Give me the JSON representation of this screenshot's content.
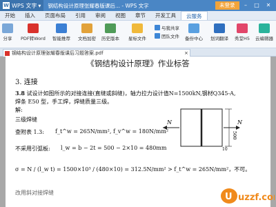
{
  "titlebar": {
    "app_name": "WPS 文字",
    "doc_title": "钢结构设计原理张耀春版课后... - WPS 文字",
    "login": "未登录"
  },
  "menu": {
    "tabs": [
      "开始",
      "插入",
      "页面布局",
      "引用",
      "审阅",
      "视图",
      "章节",
      "开发工具",
      "云服务"
    ],
    "active_index": 8
  },
  "ribbon": {
    "share": "分享",
    "pdf_to_word": "PDF转Word",
    "smart_recommend": "智能推荐",
    "doc_encrypt": "文档加密",
    "history": "历史版本",
    "write_with_share": "与我共享",
    "star_file": "星标文件",
    "team_file": "团队文件",
    "backup_center": "备份中心",
    "word_translate": "划词翻译",
    "xiuhe_h5": "秀堂H5",
    "cloud_editor": "云编辑器"
  },
  "doc_tab": {
    "label": "钢结构设计原理张耀春版课后习题答案.pdf"
  },
  "document": {
    "heading": "《钢结构设计原理》作业标答",
    "section": "3.  连接",
    "problem_num": "3.8",
    "problem_line1": "试设计如图所示的对接连接(直缝或斜缝)，轴力拉力设计值N=1500kN,钢材Q345-A,",
    "problem_line2": "焊条 E50 型，手工焊，焊缝质量三级。",
    "solution": "解:",
    "weld_level": "三级焊缝",
    "lookup": "查附表 1.3:",
    "lookup_formula": "f_t^w = 265N/mm², f_v^w = 180N/mm²",
    "no_arc": "不采用引弧板:",
    "lw_formula": "l_w = b − 2t = 500 − 2×10 = 480mm",
    "sigma_formula": "σ = N / (l_w t) = 1500×10³ / (480×10) = 312.5N/mm² > f_t^w = 265N/mm²，不可。",
    "truncated": "改用斜对接焊缝",
    "figure_labels": {
      "n_left": "N",
      "n_right": "N",
      "dim_500": "500",
      "dim_10": "10"
    }
  },
  "watermark": "uzzf.com"
}
